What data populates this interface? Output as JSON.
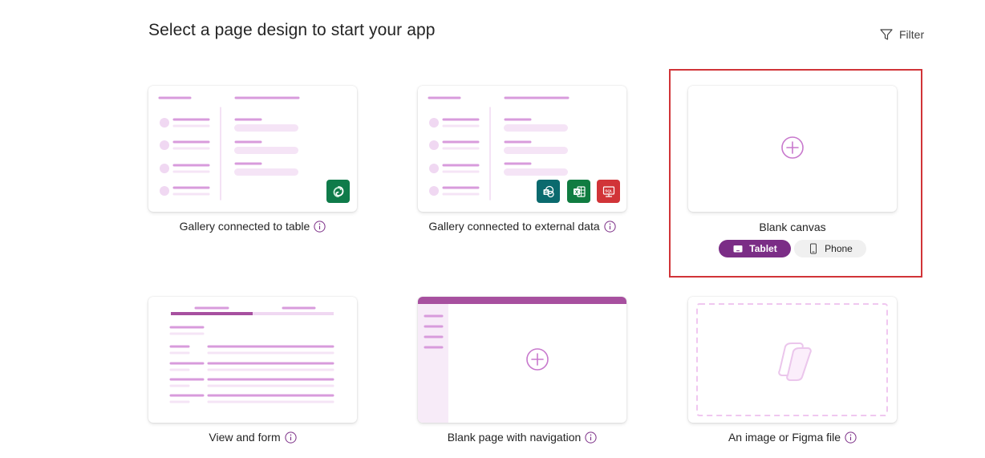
{
  "header": {
    "title": "Select a page design to start your app",
    "filter_label": "Filter"
  },
  "cards": [
    {
      "label": "Gallery connected to table",
      "has_info": true
    },
    {
      "label": "Gallery connected to external data",
      "has_info": true
    },
    {
      "label": "Blank canvas",
      "has_info": false
    },
    {
      "label": "View and form",
      "has_info": true
    },
    {
      "label": "Blank page with navigation",
      "has_info": true
    },
    {
      "label": "An image or Figma file",
      "has_info": true
    }
  ],
  "layout_toggle": {
    "options": [
      "Tablet",
      "Phone"
    ],
    "selected": "Tablet"
  },
  "icons": {
    "filter": "filter-icon",
    "info": "info-icon",
    "dataverse": "dataverse-icon",
    "sharepoint": "sharepoint-icon",
    "excel": "excel-icon",
    "sql": "sql-icon",
    "add": "plus-circle-icon",
    "copilot": "copilot-icon",
    "tablet": "tablet-icon",
    "phone": "phone-icon"
  },
  "colors": {
    "accent": "#7b2d86",
    "thumbnail_line": "#d89bdc",
    "thumbnail_fill": "#f5e4f6",
    "highlight": "#d13438",
    "dataverse": "#0f7b4a",
    "sharepoint": "#0b6a6e",
    "excel": "#107c41",
    "sql": "#d13438"
  }
}
